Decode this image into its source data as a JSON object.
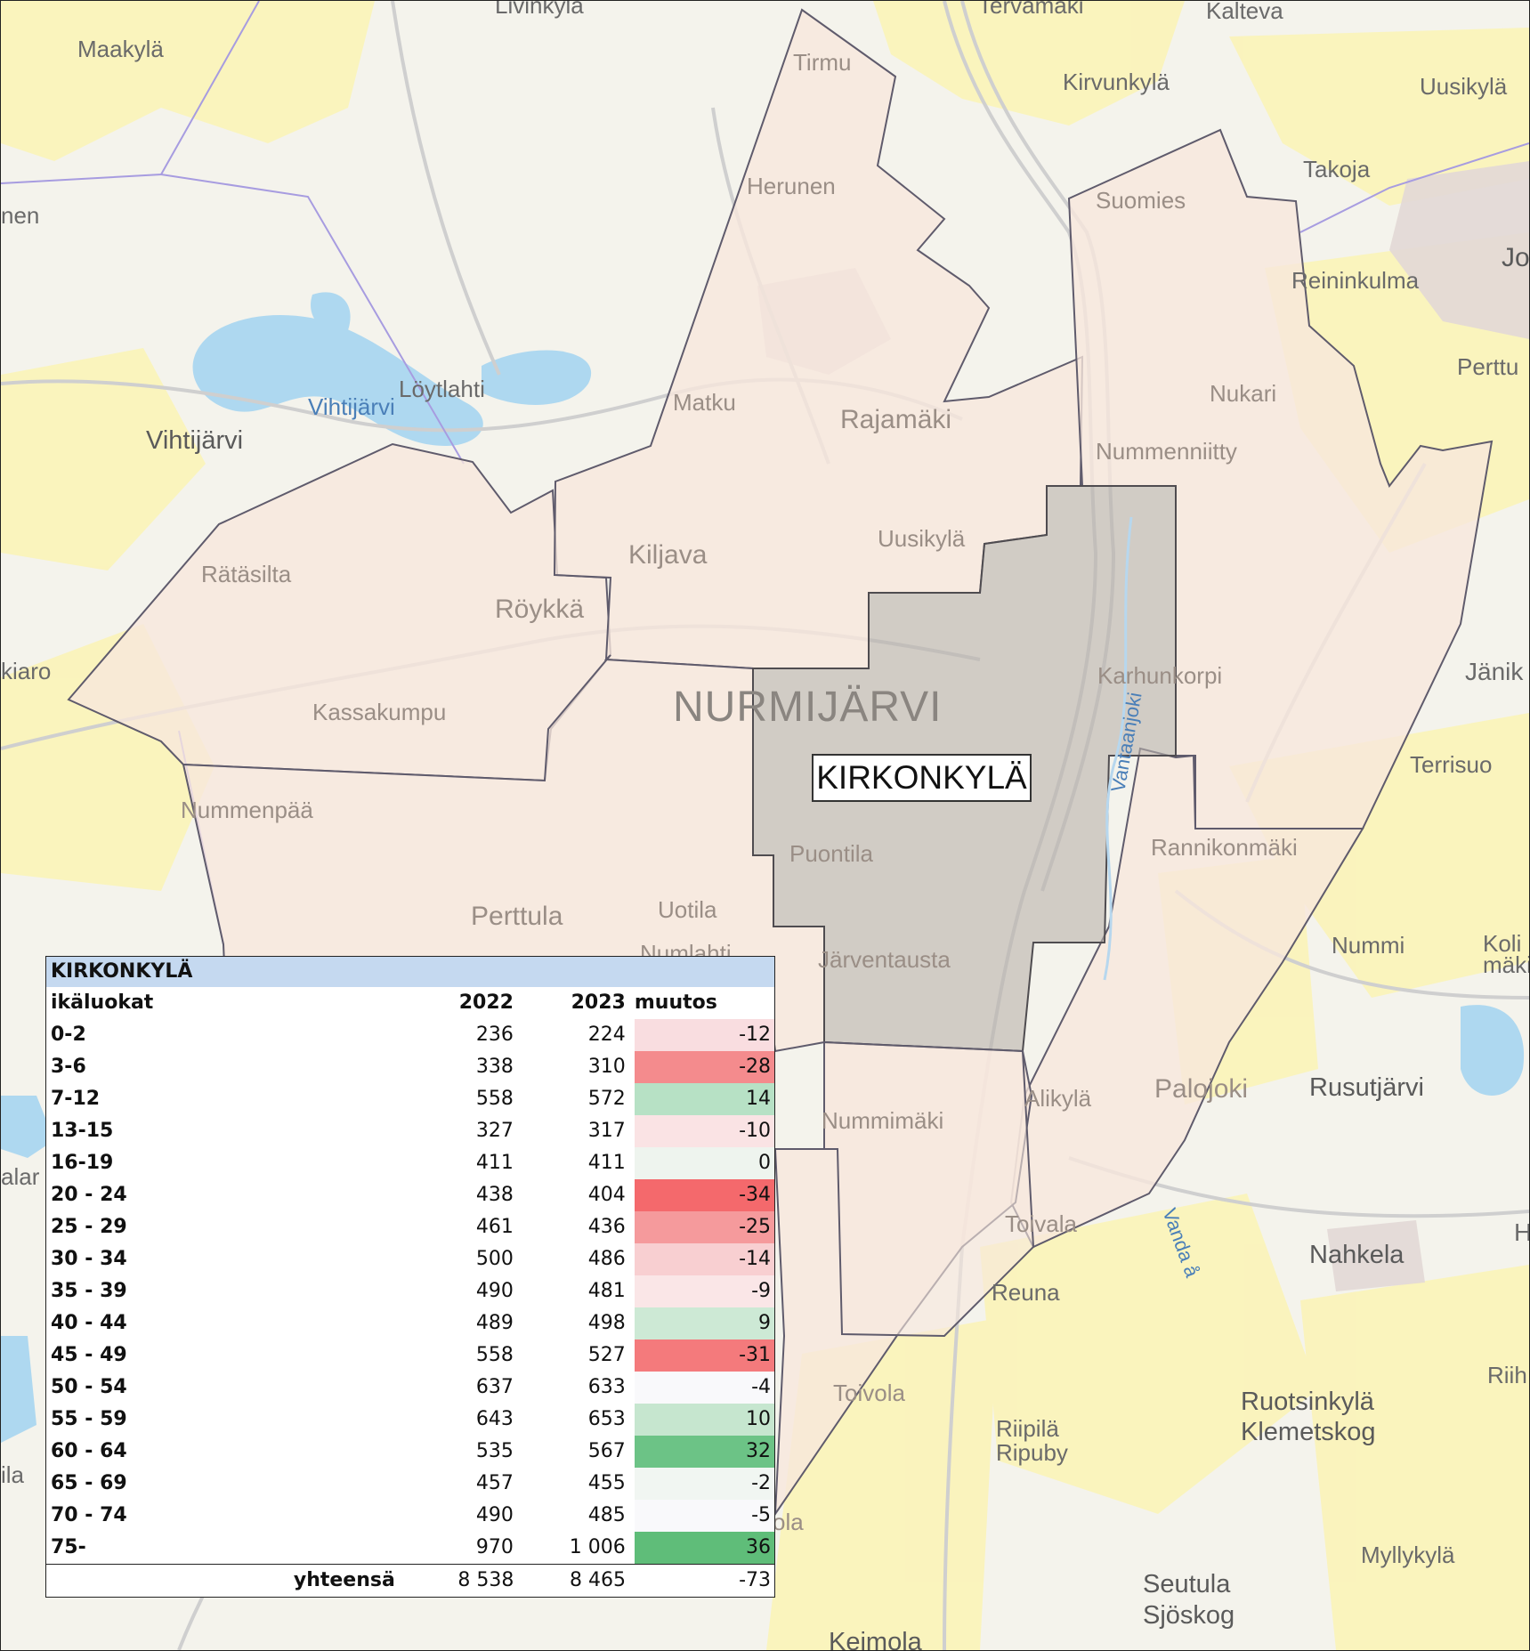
{
  "map": {
    "municipality_label": "NURMIJÄRVI",
    "area_label": "KIRKONKYLÄ",
    "places": {
      "livinkyla": "Livinkylä",
      "tervamaki": "Tervamäki",
      "kalteva": "Kalteva",
      "maakyla": "Maakylä",
      "kirvunkyla": "Kirvunkylä",
      "uusikyla_ne": "Uusikylä",
      "tirmu": "Tirmu",
      "nen": "nen",
      "takoja": "Takoja",
      "herunen": "Herunen",
      "suomies": "Suomies",
      "jo": "Jo",
      "reininkulma": "Reininkulma",
      "loytlahti": "Löytlahti",
      "vihtijarvi_lake": "Vihtijärvi",
      "vihtijarvi": "Vihtijärvi",
      "matku": "Matku",
      "rajamaki": "Rajamäki",
      "nukari": "Nukari",
      "perttu": "Perttu",
      "nummenniitty": "Nummenniitty",
      "uusikyla": "Uusikylä",
      "ratasilta": "Rätäsilta",
      "kiljava": "Kiljava",
      "roykka": "Röykkä",
      "kiaro": "kiaro",
      "karhunkorpi": "Karhunkorpi",
      "janik": "Jänik",
      "kassakumpu": "Kassakumpu",
      "terrisuo": "Terrisuo",
      "vantaanjoki": "Vantaanjoki",
      "nummenpaa": "Nummenpää",
      "rannikonmaki": "Rannikonmäki",
      "puontila": "Puontila",
      "perttula": "Perttula",
      "uotila": "Uotila",
      "nummi": "Nummi",
      "koli": "Koli",
      "maki": "mäki",
      "numlahti": "Numlahti",
      "jarventausta": "Järventausta",
      "alikyla": "Alikylä",
      "palojoki": "Palojoki",
      "rusutjarvi": "Rusutjärvi",
      "nummimaki": "Nummimäki",
      "alar": "alar",
      "toivala": "Toivala",
      "vanda_a": "Vanda å",
      "reuna": "Reuna",
      "nahkela": "Nahkela",
      "h": "H",
      "riih": "Riih",
      "toivola": "Toivola",
      "riipila": "Riipilä",
      "ripuby": "Ripuby",
      "ruotsinkyla": "Ruotsinkylä",
      "klemetskog": "Klemetskog",
      "ila": "ila",
      "ola": "ola",
      "myllykyla": "Myllykylä",
      "seutula": "Seutula",
      "sjoskog": "Sjöskog",
      "keimola": "Keimola"
    }
  },
  "table": {
    "title": "KIRKONKYLÄ",
    "headers": {
      "group": "ikäluokat",
      "y2022": "2022",
      "y2023": "2023",
      "change": "muutos"
    },
    "rows": [
      {
        "group": "0-2",
        "y2022": "236",
        "y2023": "224",
        "change": "-12",
        "color": "#f9dde0"
      },
      {
        "group": "3-6",
        "y2022": "338",
        "y2023": "310",
        "change": "-28",
        "color": "#f48b8d"
      },
      {
        "group": "7-12",
        "y2022": "558",
        "y2023": "572",
        "change": "14",
        "color": "#b7e1c5"
      },
      {
        "group": "13-15",
        "y2022": "327",
        "y2023": "317",
        "change": "-10",
        "color": "#fae3e4"
      },
      {
        "group": "16-19",
        "y2022": "411",
        "y2023": "411",
        "change": "0",
        "color": "#eef4ee"
      },
      {
        "group": "20 - 24",
        "y2022": "438",
        "y2023": "404",
        "change": "-34",
        "color": "#f4696c"
      },
      {
        "group": "25 - 29",
        "y2022": "461",
        "y2023": "436",
        "change": "-25",
        "color": "#f59a9c"
      },
      {
        "group": "30 - 34",
        "y2022": "500",
        "y2023": "486",
        "change": "-14",
        "color": "#f8cfd1"
      },
      {
        "group": "35 - 39",
        "y2022": "490",
        "y2023": "481",
        "change": "-9",
        "color": "#fae6e7"
      },
      {
        "group": "40 - 44",
        "y2022": "489",
        "y2023": "498",
        "change": "9",
        "color": "#cde9d5"
      },
      {
        "group": "45 - 49",
        "y2022": "558",
        "y2023": "527",
        "change": "-31",
        "color": "#f47a7c"
      },
      {
        "group": "50 - 54",
        "y2022": "637",
        "y2023": "633",
        "change": "-4",
        "color": "#f9f9fb"
      },
      {
        "group": "55 - 59",
        "y2022": "643",
        "y2023": "653",
        "change": "10",
        "color": "#c6e6cf"
      },
      {
        "group": "60 - 64",
        "y2022": "535",
        "y2023": "567",
        "change": "32",
        "color": "#6cc386"
      },
      {
        "group": "65 - 69",
        "y2022": "457",
        "y2023": "455",
        "change": "-2",
        "color": "#f1f6f2"
      },
      {
        "group": "70 - 74",
        "y2022": "490",
        "y2023": "485",
        "change": "-5",
        "color": "#f9f9fb"
      },
      {
        "group": "75-",
        "y2022": "970",
        "y2023": "1 006",
        "change": "36",
        "color": "#5fbd79"
      }
    ],
    "total": {
      "label": "yhteensä",
      "y2022": "8 538",
      "y2023": "8 465",
      "change": "-73"
    }
  }
}
